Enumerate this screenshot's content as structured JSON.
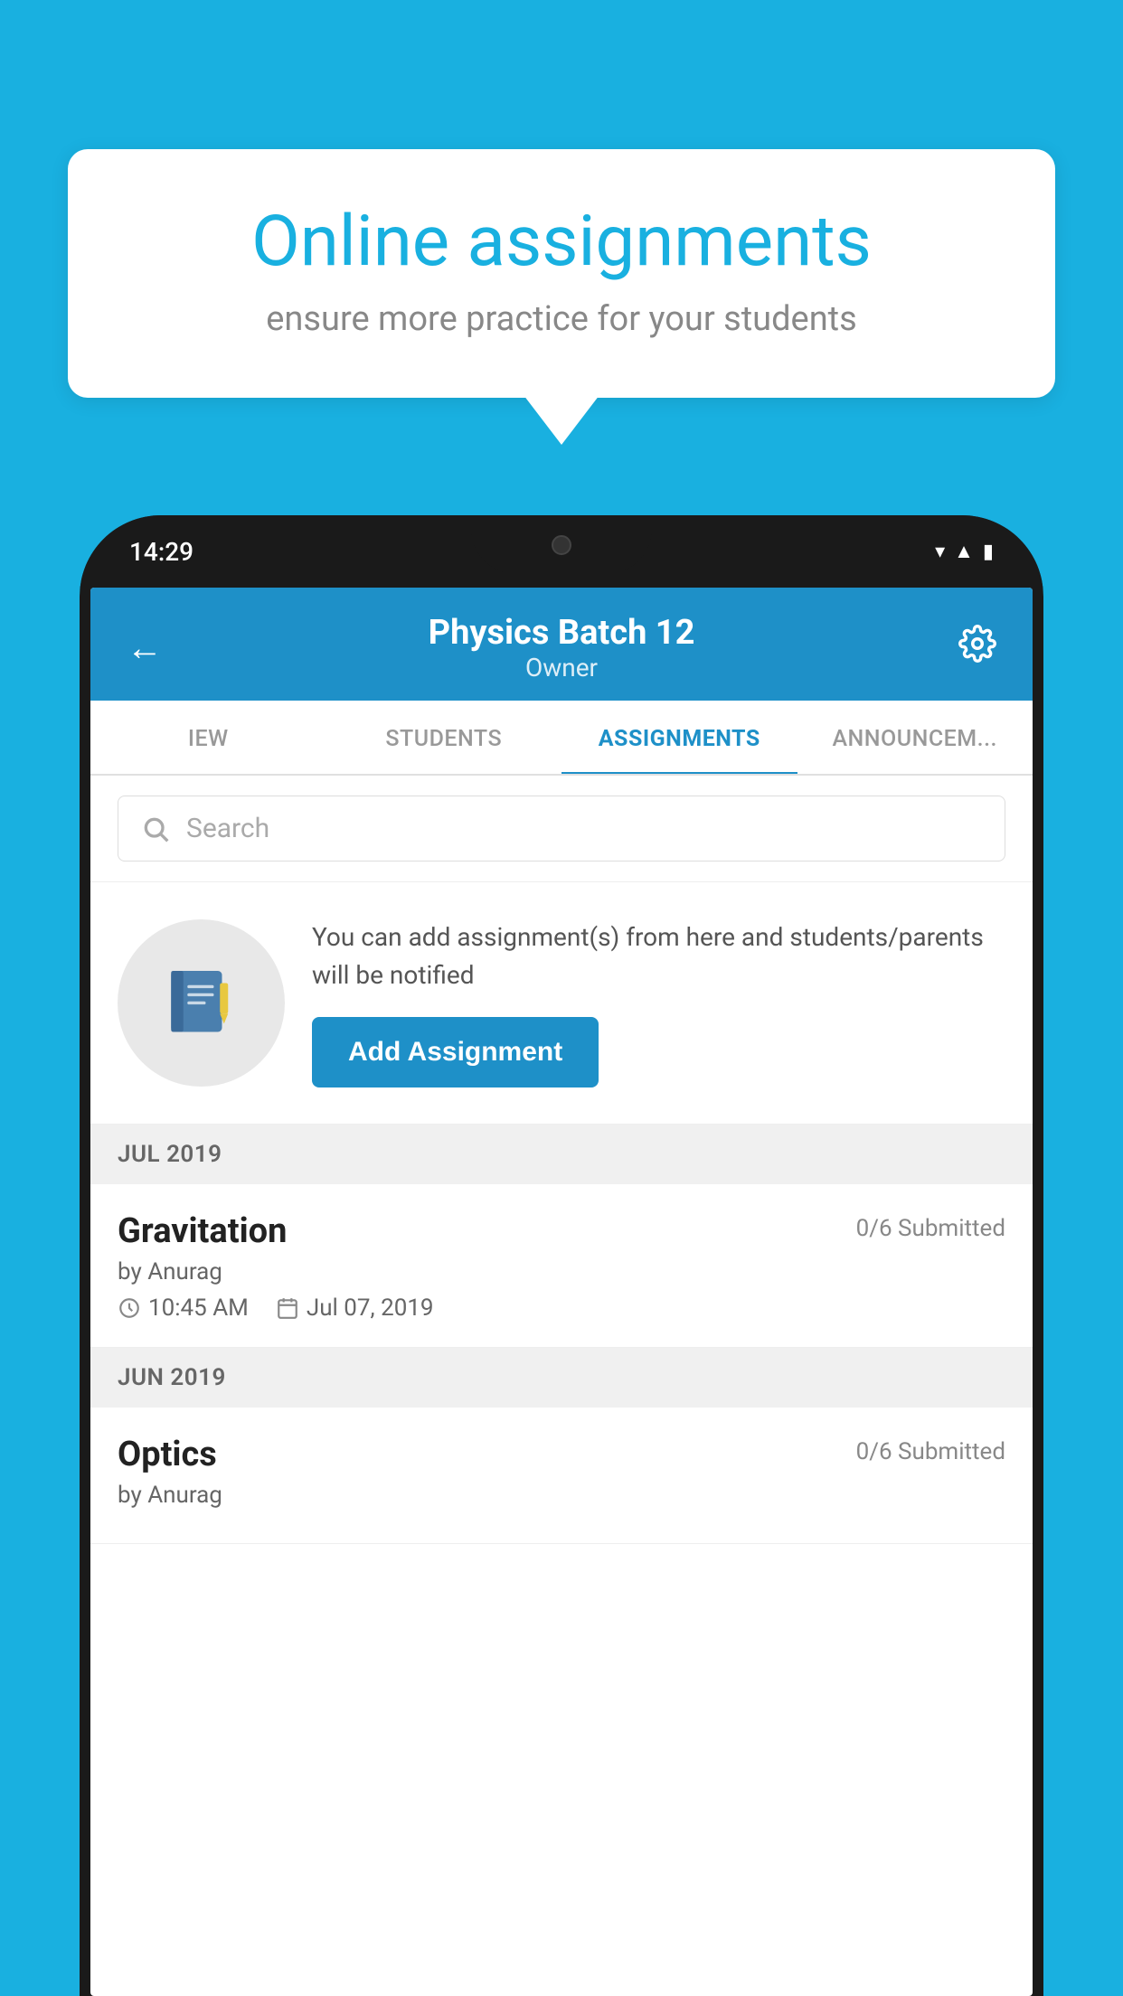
{
  "background_color": "#19B0E0",
  "speech_bubble": {
    "title": "Online assignments",
    "subtitle": "ensure more practice for your students"
  },
  "status_bar": {
    "time": "14:29",
    "icons": [
      "wifi",
      "signal",
      "battery"
    ]
  },
  "app_header": {
    "title": "Physics Batch 12",
    "subtitle": "Owner",
    "back_label": "←",
    "settings_label": "⚙"
  },
  "tabs": [
    {
      "label": "IEW",
      "active": false
    },
    {
      "label": "STUDENTS",
      "active": false
    },
    {
      "label": "ASSIGNMENTS",
      "active": true
    },
    {
      "label": "ANNOUNCEM...",
      "active": false
    }
  ],
  "search": {
    "placeholder": "Search"
  },
  "promo": {
    "description": "You can add assignment(s) from here and students/parents will be notified",
    "button_label": "Add Assignment"
  },
  "sections": [
    {
      "month": "JUL 2019",
      "assignments": [
        {
          "title": "Gravitation",
          "submitted": "0/6 Submitted",
          "author": "by Anurag",
          "time": "10:45 AM",
          "date": "Jul 07, 2019"
        }
      ]
    },
    {
      "month": "JUN 2019",
      "assignments": [
        {
          "title": "Optics",
          "submitted": "0/6 Submitted",
          "author": "by Anurag",
          "time": "",
          "date": ""
        }
      ]
    }
  ]
}
